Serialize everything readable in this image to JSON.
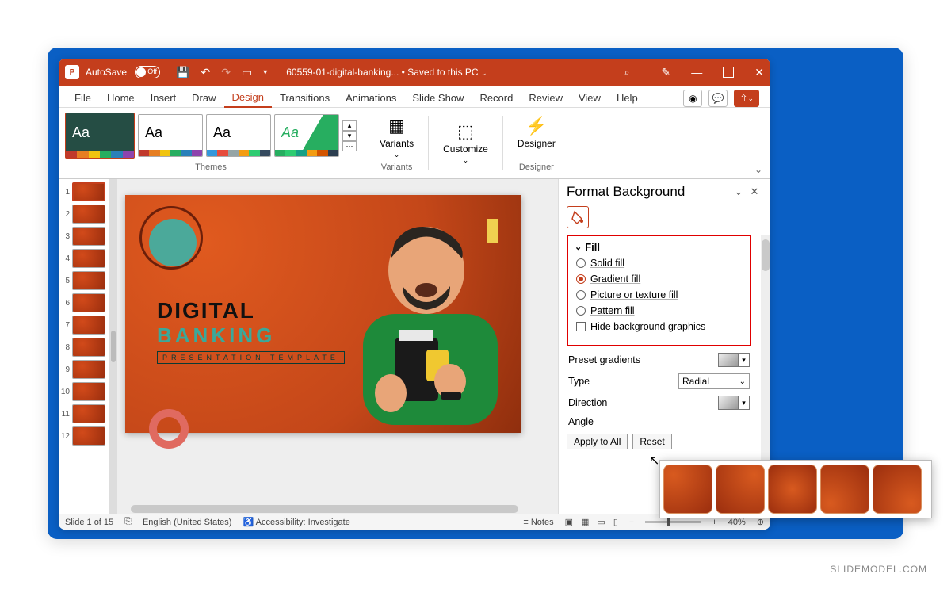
{
  "titlebar": {
    "autosave": "AutoSave",
    "toggle_state": "Off",
    "filename": "60559-01-digital-banking...",
    "saved_status": "Saved to this PC"
  },
  "ribbon_tabs": [
    "File",
    "Home",
    "Insert",
    "Draw",
    "Design",
    "Transitions",
    "Animations",
    "Slide Show",
    "Record",
    "Review",
    "View",
    "Help"
  ],
  "active_tab_index": 4,
  "ribbon": {
    "themes_label": "Themes",
    "variants_btn": "Variants",
    "variants_group": "Variants",
    "customize_btn": "Customize",
    "designer_btn": "Designer",
    "designer_group": "Designer"
  },
  "slide": {
    "title_line1": "DIGITAL",
    "title_line2": "BANKING",
    "subtitle": "PRESENTATION TEMPLATE"
  },
  "slides": [
    1,
    2,
    3,
    4,
    5,
    6,
    7,
    8,
    9,
    10,
    11,
    12
  ],
  "format_pane": {
    "title": "Format Background",
    "fill_section": "Fill",
    "solid_fill": "Solid fill",
    "gradient_fill": "Gradient fill",
    "picture_fill": "Picture or texture fill",
    "pattern_fill": "Pattern fill",
    "hide_bg": "Hide background graphics",
    "preset_gradients": "Preset gradients",
    "type_label": "Type",
    "type_value": "Radial",
    "direction_label": "Direction",
    "angle_label": "Angle",
    "apply_all": "Apply to All",
    "reset": "Reset"
  },
  "statusbar": {
    "slide_info": "Slide 1 of 15",
    "language": "English (United States)",
    "accessibility": "Accessibility: Investigate",
    "notes": "Notes",
    "zoom": "40%"
  },
  "direction_options_count": 5,
  "watermark": "SLIDEMODEL.COM"
}
